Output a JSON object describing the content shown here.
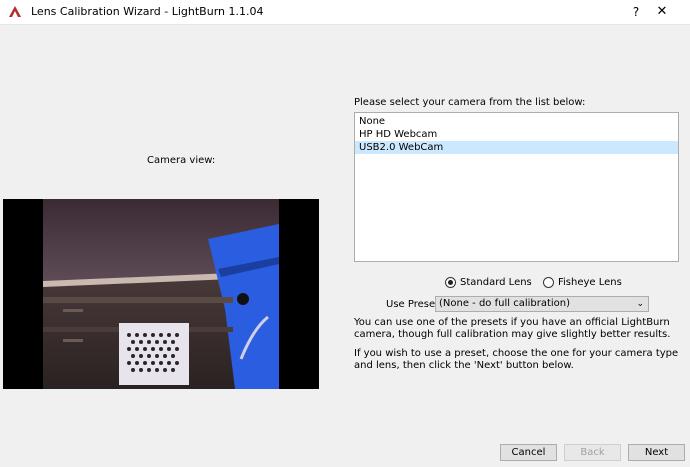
{
  "window": {
    "title": "Lens Calibration Wizard - LightBurn 1.1.04",
    "help_label": "?",
    "close_label": "✕"
  },
  "camera_view": {
    "label": "Camera view:"
  },
  "camera_list": {
    "label": "Please select your camera from the list below:",
    "items": [
      "None",
      "HP HD Webcam",
      "USB2.0 WebCam"
    ],
    "selected_index": 2
  },
  "lens": {
    "standard_label": "Standard Lens",
    "fisheye_label": "Fisheye Lens",
    "selected": "standard"
  },
  "preset": {
    "label": "Use Preset:",
    "value": "(None - do full calibration)"
  },
  "help_text": {
    "p1": "You can use one of the presets if you have an official LightBurn camera, though full calibration may give slightly better results.",
    "p2": "If you wish to use a preset, choose the one for your camera type and lens, then click the 'Next' button below."
  },
  "buttons": {
    "cancel": "Cancel",
    "back": "Back",
    "next": "Next"
  },
  "colors": {
    "selection": "#cce8ff",
    "app_icon": "#b52a2a"
  }
}
